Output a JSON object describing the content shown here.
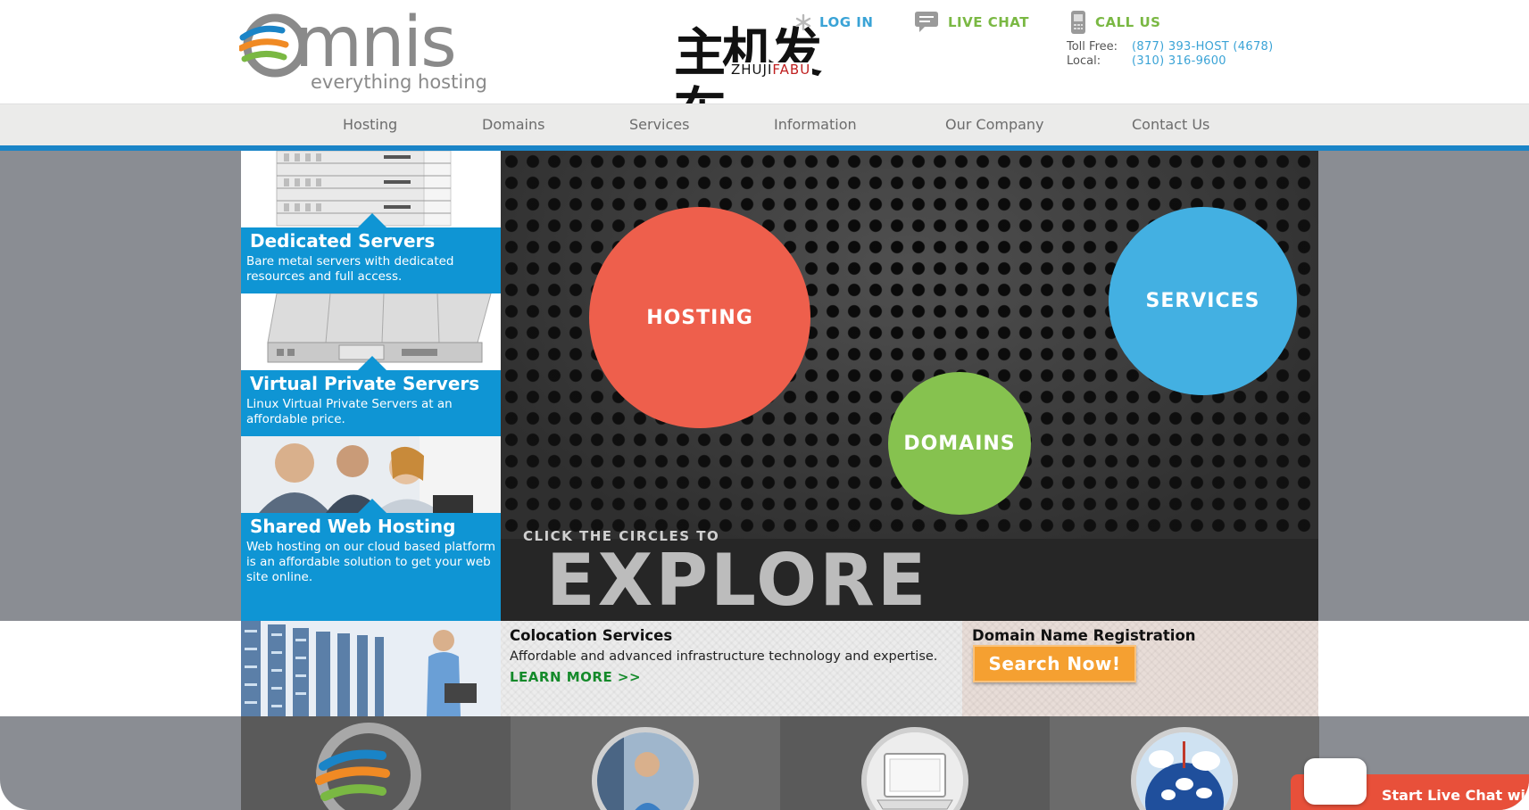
{
  "header": {
    "logo_word": "mnis",
    "logo_tagline": "everything hosting",
    "partner_cn": "主机发布",
    "partner_en_a": "ZHUJI",
    "partner_en_b": "FABU",
    "login_label": "LOG IN",
    "livechat_label": "LIVE CHAT",
    "callus_label": "CALL US",
    "toll_free_label": "Toll Free:",
    "toll_free_value": "(877) 393-HOST (4678)",
    "local_label": "Local:",
    "local_value": "(310) 316-9600"
  },
  "nav": {
    "items": [
      "Hosting",
      "Domains",
      "Services",
      "Information",
      "Our Company",
      "Contact Us"
    ]
  },
  "sidebar": {
    "cards": [
      {
        "title": "Dedicated Servers",
        "desc": "Bare metal servers with dedicated resources and full access."
      },
      {
        "title": "Virtual Private Servers",
        "desc": "Linux Virtual Private Servers at an affordable price."
      },
      {
        "title": "Shared Web Hosting",
        "desc": "Web hosting on our cloud based platform is an affordable solution to get your web site online."
      }
    ]
  },
  "hero": {
    "circle_hosting": "HOSTING",
    "circle_services": "SERVICES",
    "circle_domains": "DOMAINS",
    "small_text": "CLICK THE CIRCLES TO",
    "big_text": "EXPLORE"
  },
  "promo": {
    "coloc_title": "Colocation Services",
    "coloc_desc": "Affordable and advanced infrastructure technology and expertise.",
    "coloc_link": "LEARN MORE >>",
    "domain_title": "Domain Name Registration",
    "search_button": "Search Now!"
  },
  "livechat_widget": {
    "label": "Start Live Chat wi"
  },
  "colors": {
    "brand_blue": "#0f95d4",
    "nav_accent": "#1a84c7",
    "hosting_red": "#ee5f4c",
    "services_blue": "#43b0e2",
    "domains_green": "#86c24f",
    "link_green": "#7ab843",
    "search_orange": "#f5a031",
    "chat_red": "#e8503a"
  }
}
